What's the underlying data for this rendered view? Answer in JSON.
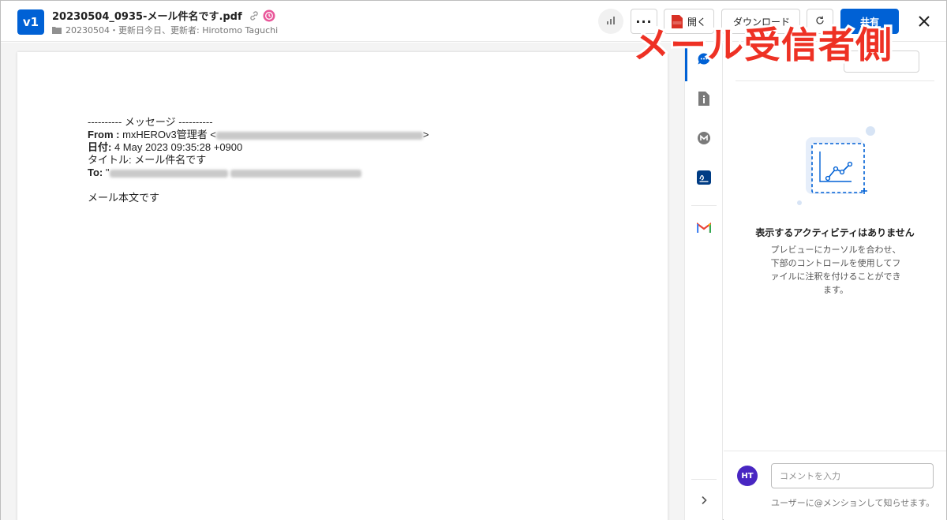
{
  "header": {
    "version_badge": "v1",
    "file_name": "20230504_0935-メール件名です.pdf",
    "folder_name": "20230504",
    "meta_separator": "・",
    "meta_text": "更新日今日、更新者: Hirotomo Taguchi",
    "more_label": "···",
    "open_label": "開く",
    "download_label": "ダウンロード",
    "share_label": "共有"
  },
  "email": {
    "separator": "---------- メッセージ ----------",
    "from_label": "From :",
    "from_value": "mxHEROv3管理者 <",
    "from_close": ">",
    "date_label": "日付:",
    "date_value": "4 May 2023 09:35:28 +0900",
    "subject_label": "タイトル:",
    "subject_value": "メール件名です",
    "to_label": "To:",
    "to_value": "\"",
    "body": "メール本文です"
  },
  "activity": {
    "empty_title": "表示するアクティビティはありません",
    "empty_description": "プレビューにカーソルを合わせ、下部のコントロールを使用してファイルに注釈を付けることができます。",
    "avatar_initials": "HT",
    "comment_placeholder": "コメントを入力",
    "comment_hint": "ユーザーに@メンションして知らせます。"
  },
  "overlay": {
    "caption": "メール受信者側"
  },
  "icons": {
    "nav": [
      "comment-icon",
      "info-icon",
      "metadata-icon",
      "sign-icon",
      "gmail-icon"
    ],
    "expand": "chevron-right-icon"
  },
  "colors": {
    "accent": "#0061d5",
    "avatar": "#4826c2",
    "overlay_caption": "#ee3124",
    "retention_badge": "#e9579a"
  }
}
